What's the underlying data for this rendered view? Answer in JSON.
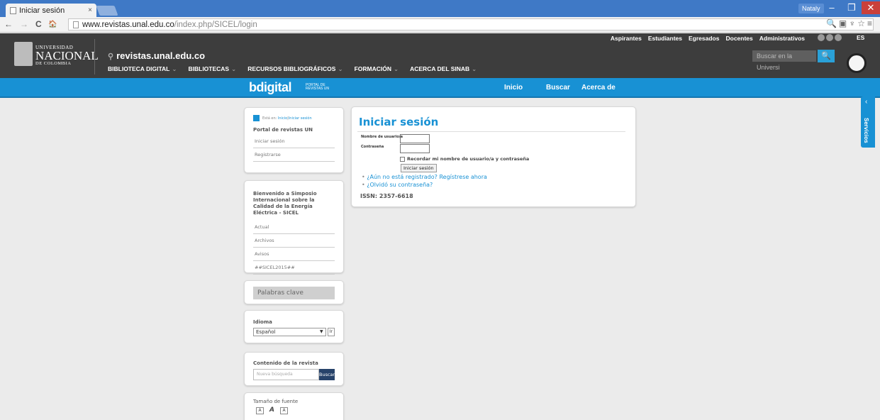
{
  "browser": {
    "tab_title": "Iniciar sesión",
    "tab_close": "×",
    "user": "Nataly",
    "min": "‒",
    "max": "❐",
    "close": "✕",
    "back": "←",
    "forward": "→",
    "reload": "C",
    "home": "🏠",
    "url_host": "www.revistas.unal.edu.co",
    "url_path": "/index.php/SICEL/login",
    "icons": "🔍▣♆☆≡"
  },
  "header": {
    "top_links": [
      "Aspirantes",
      "Estudiantes",
      "Egresados",
      "Docentes",
      "Administrativos"
    ],
    "language": "ES",
    "logo_line1": "UNIVERSIDAD",
    "logo_line2": "NACIONAL",
    "logo_line3": "DE COLOMBIA",
    "domain": "revistas.unal.edu.co",
    "menu": [
      {
        "label": "BIBLIOTECA DIGITAL",
        "caret": "⌄"
      },
      {
        "label": "BIBLIOTECAS",
        "caret": "⌄"
      },
      {
        "label": "RECURSOS BIBLIOGRÁFICOS",
        "caret": "⌄"
      },
      {
        "label": "FORMACIÓN",
        "caret": "⌄"
      },
      {
        "label": "ACERCA DEL SINAB",
        "caret": "⌄"
      }
    ],
    "search_placeholder": "Buscar en la Universi",
    "search_icon": "🔍"
  },
  "bdigital": {
    "logo": "bdigital",
    "sub": "PORTAL DE REVISTAS UN",
    "nav": [
      "Inicio",
      "Buscar",
      "Acerca de"
    ]
  },
  "side_tab": {
    "arrow": "‹",
    "label": "Servicios"
  },
  "sidebar": {
    "breadcrumb_prefix": "Está en:",
    "breadcrumb_home": "Inicio",
    "breadcrumb_sep": " | ",
    "breadcrumb_current": "Iniciar sesión",
    "portal_title": "Portal de revistas UN",
    "portal_links": [
      "Iniciar sesión",
      "Registrarse"
    ],
    "journal_title": "Bienvenido a Simposio Internacional sobre la Calidad de la Energía Eléctrica - SICEL",
    "journal_links": [
      "Actual",
      "Archivos",
      "Avisos",
      "##SICEL2015##"
    ],
    "keywords": "Palabras clave",
    "language_title": "Idioma",
    "language_value": "Español",
    "language_dropdown": "▼",
    "language_go": "Ir",
    "content_title": "Contenido de la revista",
    "search_placeholder": "Nueva búsqueda",
    "search_button": "Buscar",
    "font_title": "Tamaño de fuente",
    "font_sizes": [
      "A",
      "A",
      "A"
    ]
  },
  "login": {
    "title": "Iniciar sesión",
    "username_label": "Nombre de usuario/a",
    "password_label": "Contraseña",
    "remember_label": "Recordar mi nombre de usuario/a y contraseña",
    "submit": "Iniciar sesión",
    "register_link": "¿Aún no está registrado? Regístrese ahora",
    "forgot_link": "¿Olvidó su contraseña?",
    "issn": "ISSN: 2357-6618"
  },
  "colors": {
    "brand_blue": "#1891d4",
    "header_dark": "#3d3d3d",
    "chrome_blue": "#3f79c6"
  }
}
